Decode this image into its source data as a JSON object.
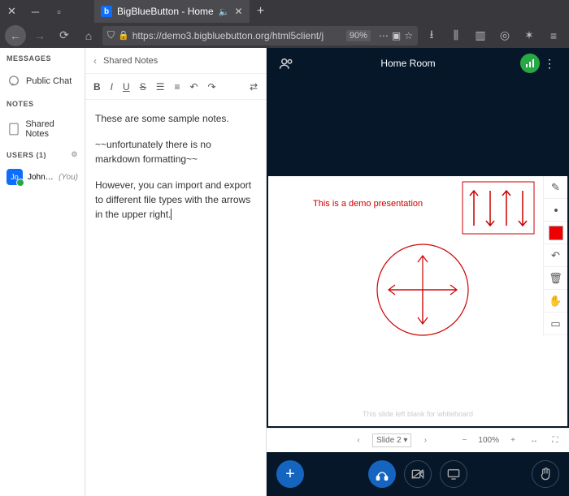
{
  "browser": {
    "tab": {
      "title": "BigBlueButton - Home",
      "favicon_letter": "b"
    },
    "url": "https://demo3.bigbluebutton.org/html5client/j",
    "zoom": "90%"
  },
  "sidebar": {
    "messages_header": "MESSAGES",
    "public_chat": "Public Chat",
    "notes_header": "NOTES",
    "shared_notes": "Shared Notes",
    "users_header": "USERS (1)",
    "user": {
      "initials": "Jo",
      "name": "John Per…",
      "you": "(You)"
    }
  },
  "notes": {
    "header": "Shared Notes",
    "toolbar": {
      "bold": "B",
      "italic": "I",
      "underline": "U",
      "strike": "S"
    },
    "p1": "These are some sample notes.",
    "p2": "~~unfortunately there is no markdown formatting~~",
    "p3": "However, you can import and export to different file types with the arrows in the upper right."
  },
  "main": {
    "room_title": "Home Room",
    "slide_text": "This is a demo presentation",
    "slide_footer": "This slide left blank for whiteboard",
    "slide_nav": {
      "label": "Slide 2",
      "zoom": "100%"
    }
  }
}
